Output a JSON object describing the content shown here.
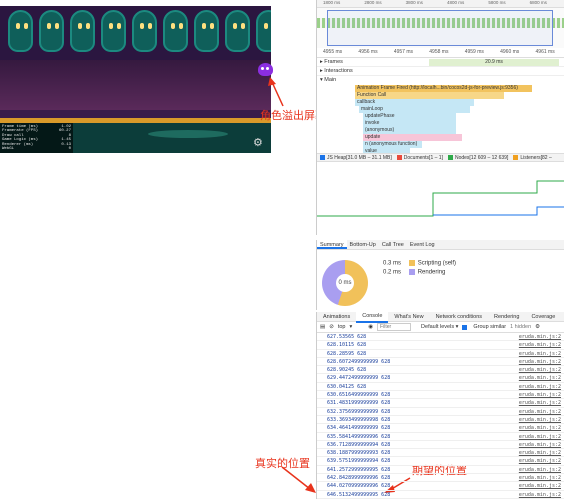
{
  "game": {
    "stats": [
      {
        "label": "Frame time (ms)",
        "value": "1.02"
      },
      {
        "label": "Framerate (FPS)",
        "value": "60.27"
      },
      {
        "label": "Draw call",
        "value": "8"
      },
      {
        "label": "Game Logic (ms)",
        "value": "1.45"
      },
      {
        "label": "Renderer (ms)",
        "value": "0.13"
      },
      {
        "label": "WebGL",
        "value": "0"
      }
    ],
    "settings_icon": "gear-icon"
  },
  "annotations": {
    "overflow": "角色溢出屏幕",
    "real_pos": "真实的位置",
    "expected_pos": "期望的位置"
  },
  "perf": {
    "ms_ticks": [
      "4955 ms",
      "4956 ms",
      "4957 ms",
      "4958 ms",
      "4959 ms",
      "4960 ms",
      "4961 ms"
    ],
    "overview_ticks": [
      "1800 ms",
      "2800 ms",
      "3800 ms",
      "4800 ms",
      "5800 ms",
      "6800 ms"
    ],
    "tracks": {
      "frames": "Frames",
      "frame_time": "20.9 ms",
      "interactions": "Interactions",
      "main": "Main"
    },
    "flames": [
      "Animation Frame Fired (http://localh...bin/cocos2d-js-for-preview.js:9356)",
      "Function Call",
      "callback",
      "mainLoop",
      "updatePhase",
      "invoke",
      "(anonymous)",
      "update",
      "n (anonymous function)",
      "value"
    ],
    "legend": [
      {
        "label": "JS Heap[31.0 MB – 31.1 MB]",
        "color": "#1a73e8"
      },
      {
        "label": "Documents[1 – 1]",
        "color": "#e84a3c"
      },
      {
        "label": "Nodes[12 609 – 12 639]",
        "color": "#2eaa4a"
      },
      {
        "label": "Listeners[82 –",
        "color": "#f0a020"
      }
    ]
  },
  "summary": {
    "tabs": [
      "Summary",
      "Bottom-Up",
      "Call Tree",
      "Event Log"
    ],
    "total": "0 ms",
    "rows": [
      {
        "value": "0.3 ms",
        "label": "Scripting (self)",
        "color": "#f1c15a"
      },
      {
        "value": "0.2 ms",
        "label": "Rendering",
        "color": "#a99ef0"
      }
    ]
  },
  "console": {
    "tabs": [
      "Animations",
      "Console",
      "What's New",
      "Network conditions",
      "Rendering",
      "Coverage"
    ],
    "context": "top",
    "filter_placeholder": "Filter",
    "levels": "Default levels ▾",
    "group_similar": "Group similar",
    "hidden": "1 hidden",
    "rows": [
      {
        "text": "627.53565 628",
        "src": "eruda.min.js:2"
      },
      {
        "text": "628.10115 628",
        "src": "eruda.min.js:2"
      },
      {
        "text": "628.28595 628",
        "src": "eruda.min.js:2"
      },
      {
        "text": "628.6072499999999 628",
        "src": "eruda.min.js:2"
      },
      {
        "text": "628.90245 628",
        "src": "eruda.min.js:2"
      },
      {
        "text": "629.4472499999999 628",
        "src": "eruda.min.js:2"
      },
      {
        "text": "630.04125 628",
        "src": "eruda.min.js:2"
      },
      {
        "text": "630.6516499999999 628",
        "src": "eruda.min.js:2"
      },
      {
        "text": "631.4831999999999 628",
        "src": "eruda.min.js:2"
      },
      {
        "text": "632.3756999999999 628",
        "src": "eruda.min.js:2"
      },
      {
        "text": "633.3693499999998 628",
        "src": "eruda.min.js:2"
      },
      {
        "text": "634.4641499999999 628",
        "src": "eruda.min.js:2"
      },
      {
        "text": "635.5841499999996 628",
        "src": "eruda.min.js:2"
      },
      {
        "text": "636.7128999999994 628",
        "src": "eruda.min.js:2"
      },
      {
        "text": "638.1887999999993 628",
        "src": "eruda.min.js:2"
      },
      {
        "text": "639.5751999999994 628",
        "src": "eruda.min.js:2"
      },
      {
        "text": "641.2572999999995 628",
        "src": "eruda.min.js:2"
      },
      {
        "text": "642.8428999999996 628",
        "src": "eruda.min.js:2"
      },
      {
        "text": "644.0270999999996 628",
        "src": "eruda.min.js:2"
      },
      {
        "text": "646.5132499999995 628",
        "src": "eruda.min.js:2"
      }
    ]
  }
}
